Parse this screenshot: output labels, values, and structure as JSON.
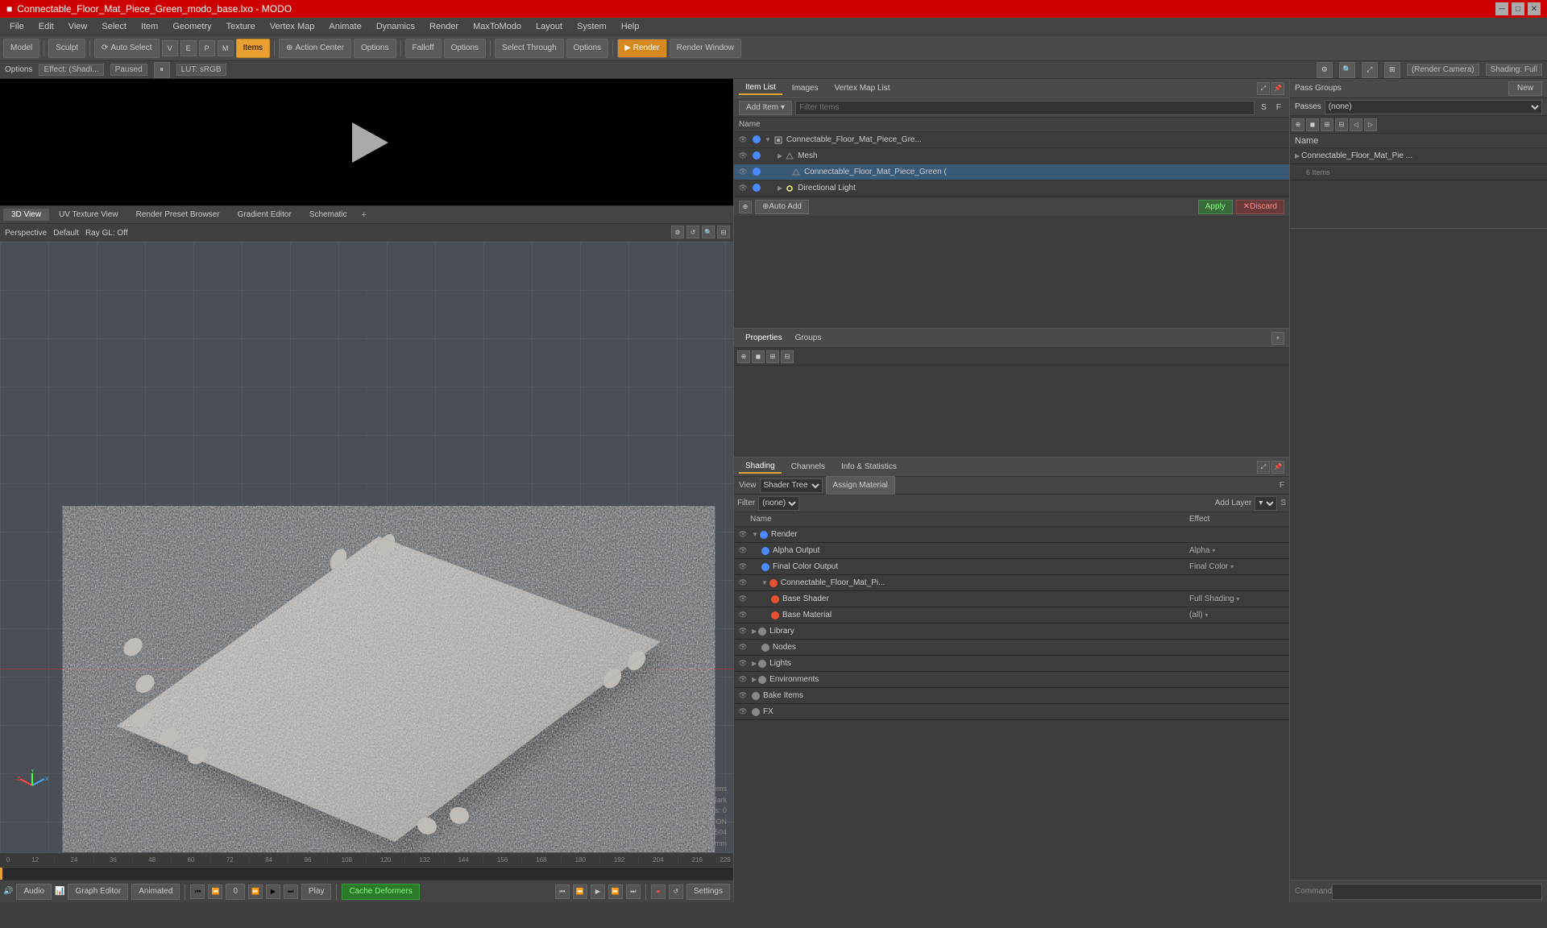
{
  "window": {
    "title": "Connectable_Floor_Mat_Piece_Green_modo_base.lxo - MODO"
  },
  "menubar": {
    "items": [
      "File",
      "Edit",
      "View",
      "Select",
      "Item",
      "Geometry",
      "Texture",
      "Vertex Map",
      "Animate",
      "Dynamics",
      "Render",
      "MaxToModo",
      "Layout",
      "System",
      "Help"
    ]
  },
  "toolbar": {
    "model_btn": "Model",
    "sculpt_btn": "Sculpt",
    "auto_select": "Auto Select",
    "items_btn": "Items",
    "action_center": "Action Center",
    "falloff": "Falloff",
    "options1": "Options",
    "options2": "Options",
    "render_btn": "Render",
    "render_window": "Render Window",
    "select_through": "Select Through"
  },
  "optionsbar": {
    "effect_label": "Options",
    "effect_val": "Effect: (Shadi...",
    "paused_label": "Paused",
    "lut_label": "LUT: sRGB",
    "camera_val": "(Render Camera)",
    "shading_val": "Shading: Full"
  },
  "viewport_tabs": {
    "tabs": [
      "3D View",
      "UV Texture View",
      "Render Preset Browser",
      "Gradient Editor",
      "Schematic"
    ],
    "add_btn": "+"
  },
  "viewport": {
    "mode": "Perspective",
    "subdiv": "Default",
    "ray_gl": "Ray GL: Off"
  },
  "viewport_status": {
    "items": "No Items",
    "polygons": "Polygons : Catmull-Clark",
    "channels": "Channels: 0",
    "deformers": "Deformers: ON",
    "gli": "GLi: 268,504",
    "distance": "20 mm"
  },
  "timeline": {
    "ticks": [
      "0",
      "12",
      "24",
      "36",
      "48",
      "60",
      "72",
      "84",
      "96",
      "108",
      "120",
      "132",
      "144",
      "156",
      "168",
      "180",
      "192",
      "204",
      "216"
    ],
    "frame": "0",
    "end": "228"
  },
  "bottom_toolbar": {
    "audio": "Audio",
    "graph_editor": "Graph Editor",
    "animated": "Animated",
    "play": "Play",
    "cache_deformers": "Cache Deformers",
    "settings": "Settings"
  },
  "item_list": {
    "tabs": [
      "Item List",
      "Images",
      "Vertex Map List"
    ],
    "add_item": "Add Item",
    "filter_placeholder": "Filter Items",
    "col_s": "S",
    "col_f": "F",
    "col_name": "Name",
    "items": [
      {
        "name": "Connectable_Floor_Mat_Piece_Gre...",
        "level": 0,
        "expanded": true,
        "type": "scene"
      },
      {
        "name": "Mesh",
        "level": 1,
        "expanded": false,
        "type": "mesh"
      },
      {
        "name": "Connectable_Floor_Mat_Piece_Green (",
        "level": 2,
        "type": "item"
      },
      {
        "name": "Directional Light",
        "level": 1,
        "type": "light"
      }
    ],
    "auto_add": "Auto Add",
    "apply": "Apply",
    "discard": "Discard"
  },
  "properties": {
    "tabs": [
      "Properties",
      "Groups"
    ],
    "add_btn": "+"
  },
  "groups": {
    "label": "Pass Groups",
    "pass_none": "(none)",
    "passes_label": "Passes",
    "passes_none": "(none)",
    "new_btn": "New",
    "col_name": "Name",
    "items": [
      {
        "name": "Connectable_Floor_Mat_Pie ...",
        "count": "6 Items"
      }
    ],
    "toolbar_icons": [
      "arrow-left",
      "arrow-right",
      "expand",
      "collapse",
      "plus",
      "minus"
    ]
  },
  "shading": {
    "panel_tabs": [
      "Shading",
      "Channels",
      "Info & Statistics"
    ],
    "view_label": "View",
    "view_val": "Shader Tree",
    "assign_material": "Assign Material",
    "filter_label": "Filter",
    "filter_none": "(none)",
    "add_layer": "Add Layer",
    "col_name": "Name",
    "col_effect": "Effect",
    "tree": [
      {
        "name": "Render",
        "effect": "",
        "level": 0,
        "expanded": true,
        "dot": "render",
        "type": "render"
      },
      {
        "name": "Alpha Output",
        "effect": "Alpha",
        "level": 1,
        "dot": "render",
        "has_arrow": true
      },
      {
        "name": "Final Color Output",
        "effect": "Final Color",
        "level": 1,
        "dot": "render",
        "has_arrow": true
      },
      {
        "name": "Connectable_Floor_Mat_Pi...",
        "effect": "",
        "level": 1,
        "dot": "mat",
        "expanded": true,
        "type": "mat"
      },
      {
        "name": "Base Shader",
        "effect": "Full Shading",
        "level": 2,
        "dot": "mat",
        "has_arrow": true
      },
      {
        "name": "Base Material",
        "effect": "(all)",
        "level": 2,
        "dot": "mat",
        "has_arrow": true
      },
      {
        "name": "Library",
        "effect": "",
        "level": 1,
        "dot": "base",
        "expanded": false
      },
      {
        "name": "Nodes",
        "effect": "",
        "level": 2,
        "dot": "base"
      },
      {
        "name": "Lights",
        "effect": "",
        "level": 1,
        "dot": "base",
        "expanded": false
      },
      {
        "name": "Environments",
        "effect": "",
        "level": 1,
        "dot": "base",
        "expanded": false
      },
      {
        "name": "Bake Items",
        "effect": "",
        "level": 1,
        "dot": "base"
      },
      {
        "name": "FX",
        "effect": "",
        "level": 1,
        "dot": "base"
      }
    ]
  },
  "command_bar": {
    "label": "Command"
  }
}
